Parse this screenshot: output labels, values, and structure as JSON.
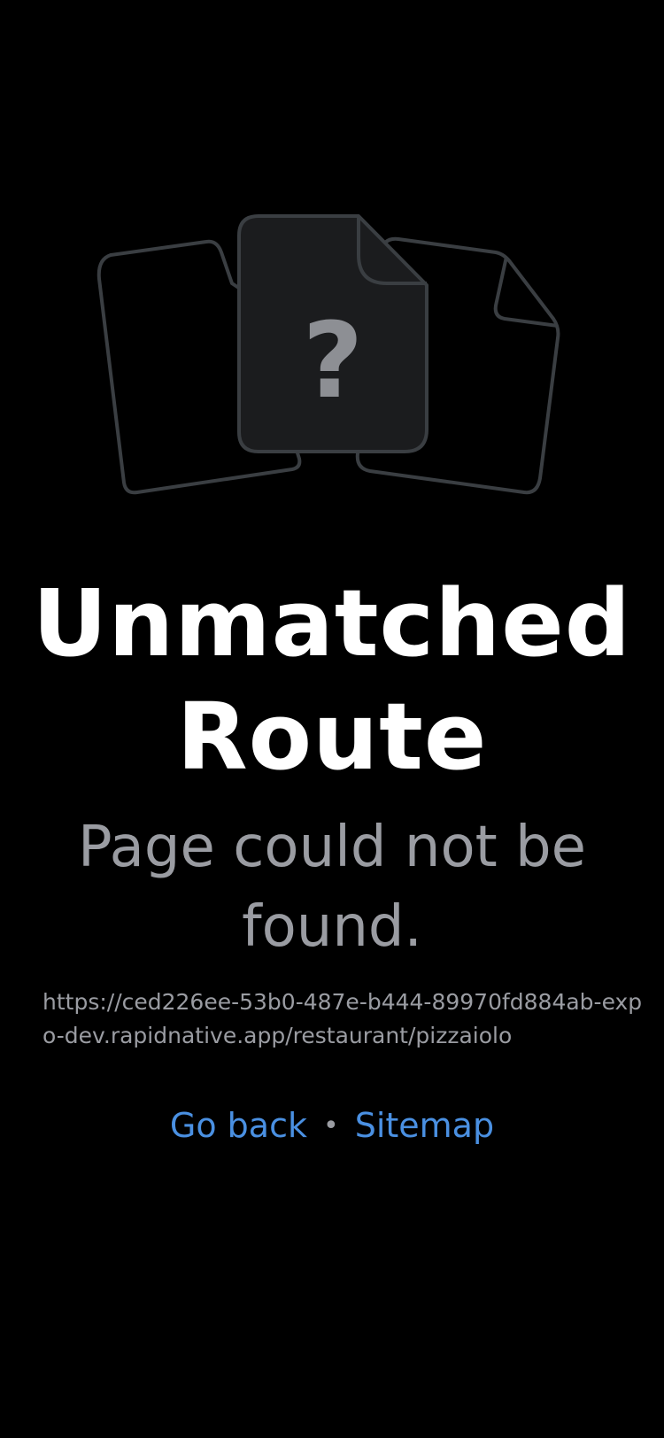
{
  "illustration": {
    "question_mark": "?",
    "icon": "documents-question-icon"
  },
  "title": "Unmatched Route",
  "subtitle": "Page could not be found.",
  "url": "https://ced226ee-53b0-487e-b444-89970fd884ab-expo-dev.rapidnative.app/restaurant/pizzaiolo",
  "links": {
    "go_back": "Go back",
    "separator": "•",
    "sitemap": "Sitemap"
  },
  "colors": {
    "background": "#000000",
    "title": "#ffffff",
    "muted": "#9a9ca2",
    "link": "#4a90e2",
    "doc_stroke": "#3a3e42",
    "doc_fill": "#1b1c1e"
  }
}
